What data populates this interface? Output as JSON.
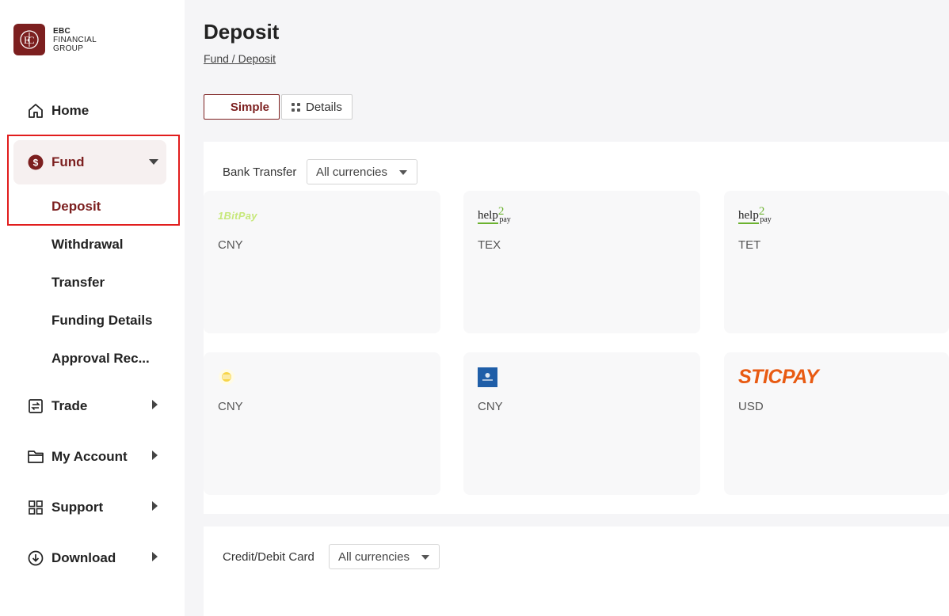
{
  "brand": {
    "line1": "EBC",
    "line2": "FINANCIAL",
    "line3": "GROUP",
    "mark": "ebc-monogram",
    "color": "#7c1f1f"
  },
  "sidebar": {
    "items": [
      {
        "label": "Home",
        "icon": "home-icon"
      },
      {
        "label": "Fund",
        "icon": "dollar-circle-icon",
        "expanded": true
      },
      {
        "label": "Trade",
        "icon": "transfer-icon"
      },
      {
        "label": "My Account",
        "icon": "folder-icon"
      },
      {
        "label": "Support",
        "icon": "grid-icon"
      },
      {
        "label": "Download",
        "icon": "download-icon"
      }
    ],
    "fund_sub": [
      "Deposit",
      "Withdrawal",
      "Transfer",
      "Funding Details",
      "Approval Rec..."
    ]
  },
  "page": {
    "title": "Deposit",
    "breadcrumb_root": "Fund",
    "breadcrumb_sep": " /",
    "breadcrumb_current": " Deposit"
  },
  "view_toggle": {
    "simple": "Simple",
    "details": "Details",
    "selected": "Simple"
  },
  "sections": [
    {
      "label": "Bank Transfer",
      "filter": "All currencies",
      "cards": [
        {
          "provider_logo": "1BitPay",
          "currency": "CNY"
        },
        {
          "provider_logo": "help2pay",
          "currency": "TEX"
        },
        {
          "provider_logo": "help2pay",
          "currency": "TET"
        },
        {
          "provider_logo": "yellow-coin",
          "currency": "CNY"
        },
        {
          "provider_logo": "blue-square",
          "currency": "CNY"
        },
        {
          "provider_logo": "STICPAY",
          "currency": "USD"
        }
      ]
    },
    {
      "label": "Credit/Debit Card",
      "filter": "All currencies"
    }
  ],
  "logos": {
    "bitpay_text": "1BitPay",
    "help2pay_help": "help",
    "help2pay_two": "2",
    "help2pay_pay": "pay",
    "sticpay_text": "STICPAY"
  }
}
